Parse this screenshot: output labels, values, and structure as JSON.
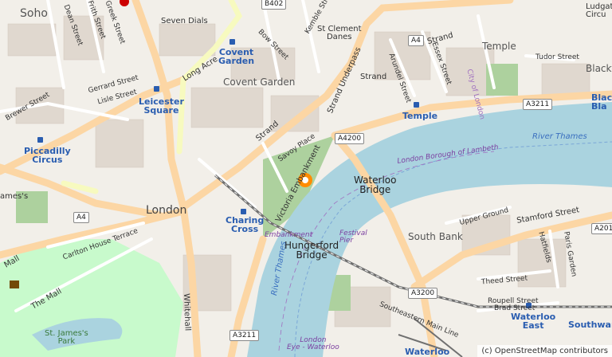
{
  "labels": {
    "soho": "Soho",
    "seven_dials": "Seven Dials",
    "covent_garden_station": "Covent\nGarden",
    "covent_garden_area": "Covent Garden",
    "st_clement_danes": "St Clement\nDanes",
    "temple_area": "Temple",
    "temple_station": "Temple",
    "ludgate_circus": "Ludgat\nCircu",
    "blackfriars": "Blackf",
    "blackfriars_station": "Blac\nBla",
    "leicester_square": "Leicester\nSquare",
    "piccadilly_circus": "Piccadilly\nCircus",
    "james_s": "ames's",
    "london": "London",
    "charing_cross": "Charing\nCross",
    "embankment": "Embankment",
    "hungerford_bridge": "Hungerford\nBridge",
    "waterloo_bridge": "Waterloo\nBridge",
    "festival_pier": "Festival\nPier",
    "river_thames_1": "River Thames",
    "river_thames_2": "River Thames",
    "london_borough_lambeth": "London Borough of Lambeth",
    "south_bank": "South Bank",
    "waterloo_east": "Waterloo\nEast",
    "southwark": "Southwark",
    "waterloo": "Waterloo",
    "london_eye_waterloo": "London\nEye - Waterloo",
    "st_jamess_park": "St. James's\nPark",
    "st_james_short": "St. J",
    "southeastern_main_line": "Southeastern Main Line",
    "savoy_place": "Savoy Place",
    "victoria_embankment": "Victoria Embankment",
    "strand_1": "Strand",
    "strand_2": "Strand",
    "strand_3": "Strand",
    "strand_underpass": "Strand Underpass",
    "long_acre": "Long Acre",
    "dean_street": "Dean Street",
    "frith_street": "Frith Street",
    "greek_street": "Greek Street",
    "gerrard_street": "Gerrard Street",
    "lisle_street": "Lisle Street",
    "brewer_street": "Brewer Street",
    "bow_street": "Bow Street",
    "kemble_street": "Kemble Street",
    "arundel_street": "Arundel Street",
    "essex_street": "Essex Street",
    "tudor_street": "Tudor Street",
    "city_of_london": "City of London",
    "upper_ground": "Upper Ground",
    "stamford_street": "Stamford Street",
    "hatfields": "Hatfields",
    "paris_garden": "Paris Garden",
    "theed_street": "Theed Street",
    "roupell_street": "Roupell Street",
    "brad_street": "Brad Street",
    "carlton_house_terrace": "Carlton House Terrace",
    "the_mall": "The Mall",
    "mall_west": "Mall",
    "whitehall": "Whitehall"
  },
  "road_shields": {
    "b402": "B402",
    "a4_strand": "A4",
    "a4200": "A4200",
    "a3211_east": "A3211",
    "a4_west": "A4",
    "a3200": "A3200",
    "a3211_south": "A3211",
    "a201": "A201"
  },
  "marker": {
    "icon": "location-pin-icon",
    "color": "#ff8c00"
  },
  "attribution": "(c) OpenStreetMap contributors",
  "colors": {
    "land": "#f2efe9",
    "water": "#aad3df",
    "major_road": "#fcd6a4",
    "secondary_road": "#f7fabf",
    "park": "#c8facc",
    "building": "#d9d0c9",
    "rail": "#707070"
  }
}
